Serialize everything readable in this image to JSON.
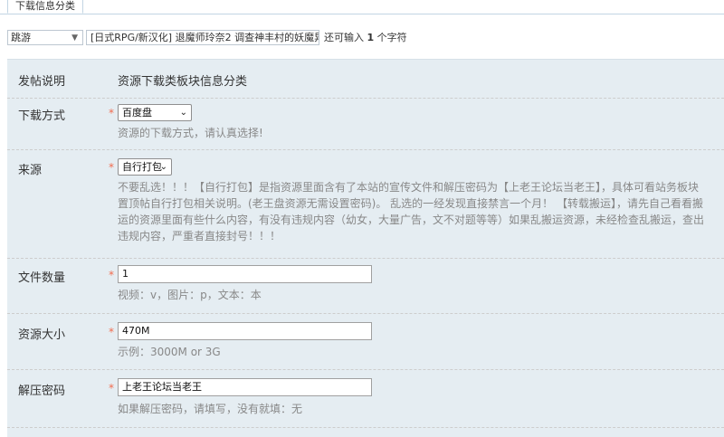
{
  "tab": {
    "label": "下载信息分类"
  },
  "top": {
    "type_select": "跳游",
    "title_value": "[日式RPG/新汉化] 退魔师玲奈2 调查神丰村的妖魔异变 ",
    "hint_prefix": "还可输入",
    "hint_count": "1",
    "hint_suffix": "个字符"
  },
  "form": {
    "intro": {
      "label": "发帖说明",
      "text": "资源下载类板块信息分类"
    },
    "download_method": {
      "label": "下载方式",
      "required": "*",
      "selected": "百度盘",
      "desc": "资源的下载方式，请认真选择!"
    },
    "source": {
      "label": "来源",
      "required": "*",
      "selected": "自行打包",
      "desc_lines": [
        "不要乱选！！！【自行打包】是指资源里面含有了本站的宣传文件和解压密码为【上老王论坛当老王】，具体可看站务板块",
        "置顶帖自行打包相关说明。(老王盘资源无需设置密码)。 乱选的一经发现直接禁言一个月！ 【转载搬运】，请先自己看看搬",
        "运的资源里面有些什么内容，有没有违规内容（幼女，大量广告，文不对题等等）如果乱搬运资源，未经检查乱搬运，查出",
        "违规内容，严重者直接封号！！！"
      ]
    },
    "file_count": {
      "label": "文件数量",
      "required": "*",
      "value": "1",
      "desc": "视频：v，图片：p，文本：本"
    },
    "resource_size": {
      "label": "资源大小",
      "required": "*",
      "value": "470M",
      "desc": "示例：3000M or 3G"
    },
    "password": {
      "label": "解压密码",
      "required": "*",
      "value": "上老王论坛当老王",
      "desc": "如果解压密码，请填写，没有就填：无"
    }
  }
}
